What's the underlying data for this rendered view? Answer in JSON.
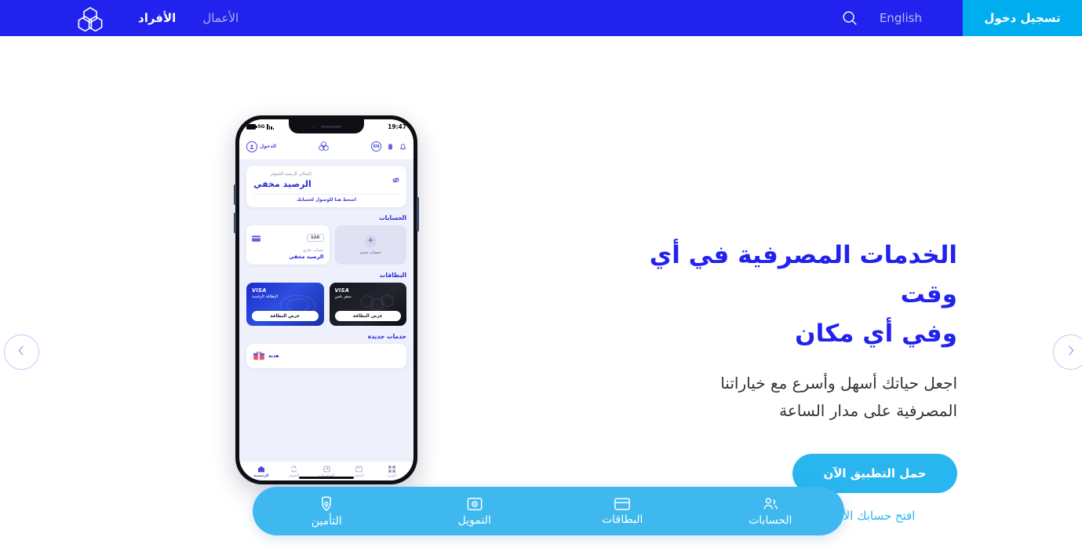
{
  "header": {
    "login_label": "تسجيل دخول",
    "language_label": "English",
    "search_icon": "search-icon",
    "nav_business": "الأعمال",
    "nav_individuals": "الأفراد",
    "brand_icon": "trefoil-logo-icon"
  },
  "hero": {
    "heading_line1": "الخدمات المصرفية في أي وقت",
    "heading_line2": "وفي أي مكان",
    "subtitle_line1": "اجعل حياتك أسهل وأسرع مع خياراتنا",
    "subtitle_line2": "المصرفية على مدار الساعة",
    "cta_primary": "حمل التطبيق الآن",
    "cta_secondary": "افتح حسابك الآن"
  },
  "carousel": {
    "prev_icon": "chevron-left-icon",
    "next_icon": "chevron-right-icon"
  },
  "phone": {
    "status": {
      "time": "19:47",
      "network": "5G",
      "signal_icon": "signal-bars-icon",
      "battery_icon": "battery-icon"
    },
    "app_header": {
      "bell_icon": "bell-icon",
      "fingerprint_icon": "fingerprint-icon",
      "lang_badge": "EN",
      "logo_icon": "trefoil-logo-icon",
      "login_label": "الدخول",
      "avatar_icon": "user-avatar-icon"
    },
    "balance": {
      "label": "إجمالي الرصيد المتوفر",
      "value": "الرصيد مخفي",
      "link": "اضغط هنا للوصول لحسابك",
      "eye_icon": "eye-off-icon"
    },
    "accounts": {
      "title": "الحسابات",
      "new_account_label": "حساب جديد",
      "new_account_icon": "plus-icon",
      "card": {
        "currency": "SAR",
        "card_icon": "card-icon",
        "type": "حساب جاري",
        "balance": "الرصيد مخفي"
      }
    },
    "cards": {
      "title": "البطاقات",
      "items": [
        {
          "brand": "VISA",
          "name": "سفر بلس",
          "button": "عرض البطاقة",
          "theme": "black"
        },
        {
          "brand": "VISA",
          "name": "البطاقة الرقمية",
          "button": "عرض البطاقة",
          "theme": "blue"
        }
      ]
    },
    "services": {
      "title": "خدمات جديدة",
      "item_label": "هدية",
      "item_icon": "gift-icon"
    },
    "tabbar": [
      {
        "label": "الرئيسية",
        "icon": "home-icon",
        "active": true
      },
      {
        "label": "التحويل",
        "icon": "transfer-icon",
        "active": false
      },
      {
        "label": "المدفوعات",
        "icon": "payments-icon",
        "active": false
      },
      {
        "label": "المتجر",
        "icon": "store-icon",
        "active": false
      },
      {
        "label": "المزيد",
        "icon": "grid-more-icon",
        "active": false
      }
    ]
  },
  "floatbar": {
    "items": [
      {
        "label": "الحسابات",
        "icon": "accounts-people-icon"
      },
      {
        "label": "البطاقات",
        "icon": "cards-icon"
      },
      {
        "label": "التمويل",
        "icon": "financing-icon"
      },
      {
        "label": "التأمين",
        "icon": "insurance-shield-icon"
      }
    ]
  },
  "colors": {
    "header_blue": "#2222ee",
    "login_cyan": "#00aeef",
    "brand_blue": "#2222ee",
    "cta_blue": "#29b6ef",
    "floatbar_blue": "#3fb8ef"
  }
}
